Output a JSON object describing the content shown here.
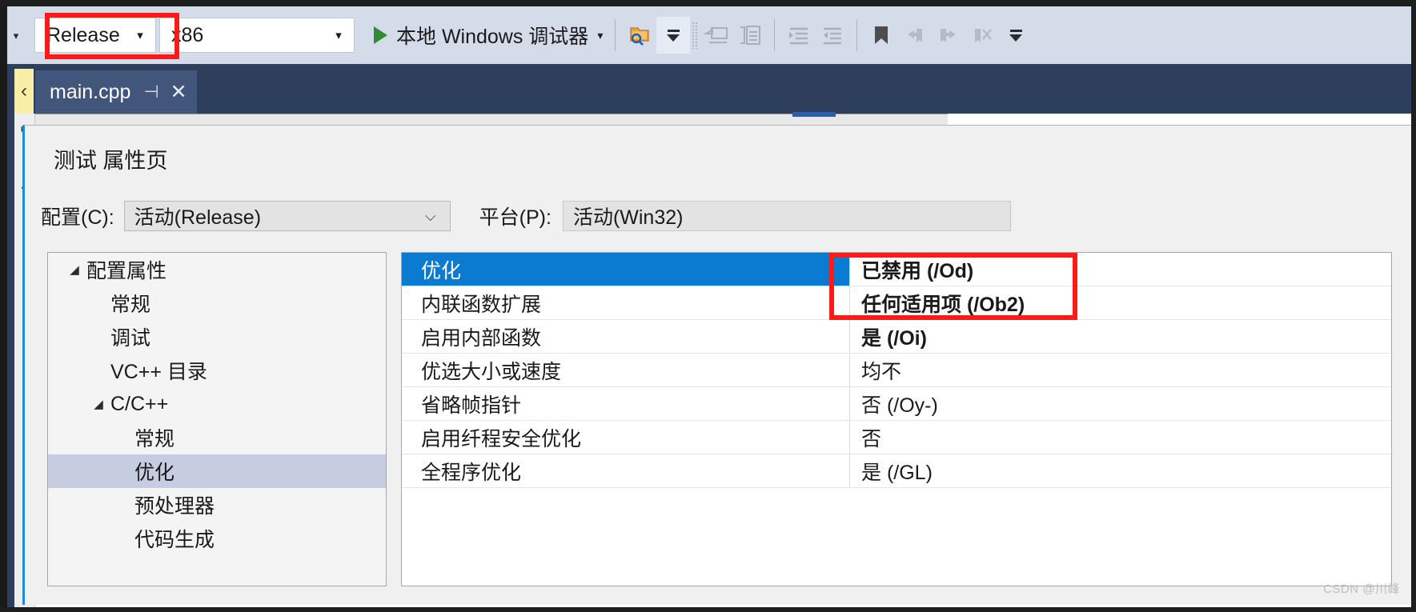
{
  "toolbar": {
    "config_selector": {
      "value": "Release",
      "arrow": "▾"
    },
    "platform_selector": {
      "value": "x86",
      "arrow": "▾"
    },
    "run_button": {
      "label": "本地 Windows 调试器",
      "arrow": "▾",
      "play_icon": "play-triangle-icon"
    },
    "icons": [
      {
        "name": "find-in-folder-icon"
      },
      {
        "name": "toolbar-overflow-icon"
      },
      {
        "name": "comment-block-icon"
      },
      {
        "name": "uncomment-block-icon"
      },
      {
        "name": "increase-indent-icon"
      },
      {
        "name": "decrease-indent-icon"
      },
      {
        "name": "toggle-bookmark-icon"
      },
      {
        "name": "previous-bookmark-icon"
      },
      {
        "name": "next-bookmark-icon"
      },
      {
        "name": "clear-bookmarks-icon"
      }
    ]
  },
  "tabstrip": {
    "tab": {
      "label": "main.cpp",
      "pin_icon": "⊣",
      "close_icon": "✕"
    },
    "left_marker": "‹"
  },
  "dialog": {
    "title": "测试 属性页",
    "configuration": {
      "label": "配置(C):",
      "value": "活动(Release)",
      "chevron": "⌵"
    },
    "platform": {
      "label": "平台(P):",
      "value": "活动(Win32)"
    },
    "tree": [
      {
        "label": "配置属性",
        "indent": 0,
        "arrow": "◢",
        "selected": false
      },
      {
        "label": "常规",
        "indent": 1,
        "arrow": "",
        "selected": false
      },
      {
        "label": "调试",
        "indent": 1,
        "arrow": "",
        "selected": false
      },
      {
        "label": "VC++ 目录",
        "indent": 1,
        "arrow": "",
        "selected": false
      },
      {
        "label": "C/C++",
        "indent": 1,
        "arrow": "◢",
        "selected": false
      },
      {
        "label": "常规",
        "indent": 2,
        "arrow": "",
        "selected": false
      },
      {
        "label": "优化",
        "indent": 2,
        "arrow": "",
        "selected": true
      },
      {
        "label": "预处理器",
        "indent": 2,
        "arrow": "",
        "selected": false
      },
      {
        "label": "代码生成",
        "indent": 2,
        "arrow": "",
        "selected": false
      }
    ],
    "properties": [
      {
        "name": "优化",
        "value": "已禁用 (/Od)",
        "selected": true,
        "bold": true
      },
      {
        "name": "内联函数扩展",
        "value": "任何适用项 (/Ob2)",
        "selected": false,
        "bold": true
      },
      {
        "name": "启用内部函数",
        "value": "是 (/Oi)",
        "selected": false,
        "bold": true
      },
      {
        "name": "优选大小或速度",
        "value": "均不",
        "selected": false,
        "bold": false
      },
      {
        "name": "省略帧指针",
        "value": "否 (/Oy-)",
        "selected": false,
        "bold": false
      },
      {
        "name": "启用纤程安全优化",
        "value": "否",
        "selected": false,
        "bold": false
      },
      {
        "name": "全程序优化",
        "value": "是 (/GL)",
        "selected": false,
        "bold": false
      }
    ]
  },
  "annotations": {
    "release_highlight": "red-rectangle-release",
    "values_highlight": "red-rectangle-optimization-values",
    "accent_color": "#ff1a1a",
    "selection_color": "#0b7ad1"
  },
  "watermark": "CSDN @川峰"
}
